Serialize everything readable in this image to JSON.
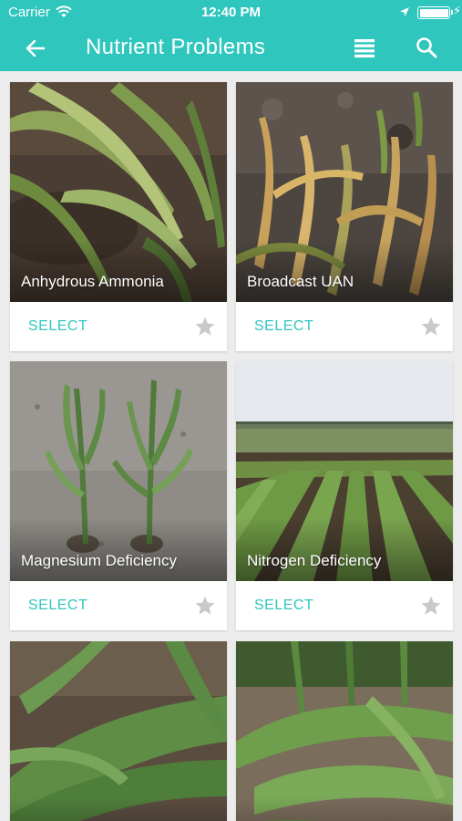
{
  "status_bar": {
    "carrier": "Carrier",
    "time": "12:40 PM"
  },
  "header": {
    "title": "Nutrient Problems",
    "back_icon": "arrow-left-icon",
    "list_icon": "list-view-icon",
    "search_icon": "search-icon"
  },
  "colors": {
    "accent": "#2fc6bd",
    "star_inactive": "#c9c9c9"
  },
  "cards": [
    {
      "label": "Anhydrous Ammonia",
      "action": "SELECT"
    },
    {
      "label": "Broadcast UAN",
      "action": "SELECT"
    },
    {
      "label": "Magnesium Deficiency",
      "action": "SELECT"
    },
    {
      "label": "Nitrogen Deficiency",
      "action": "SELECT"
    },
    {
      "label": "",
      "action": ""
    },
    {
      "label": "",
      "action": ""
    }
  ]
}
